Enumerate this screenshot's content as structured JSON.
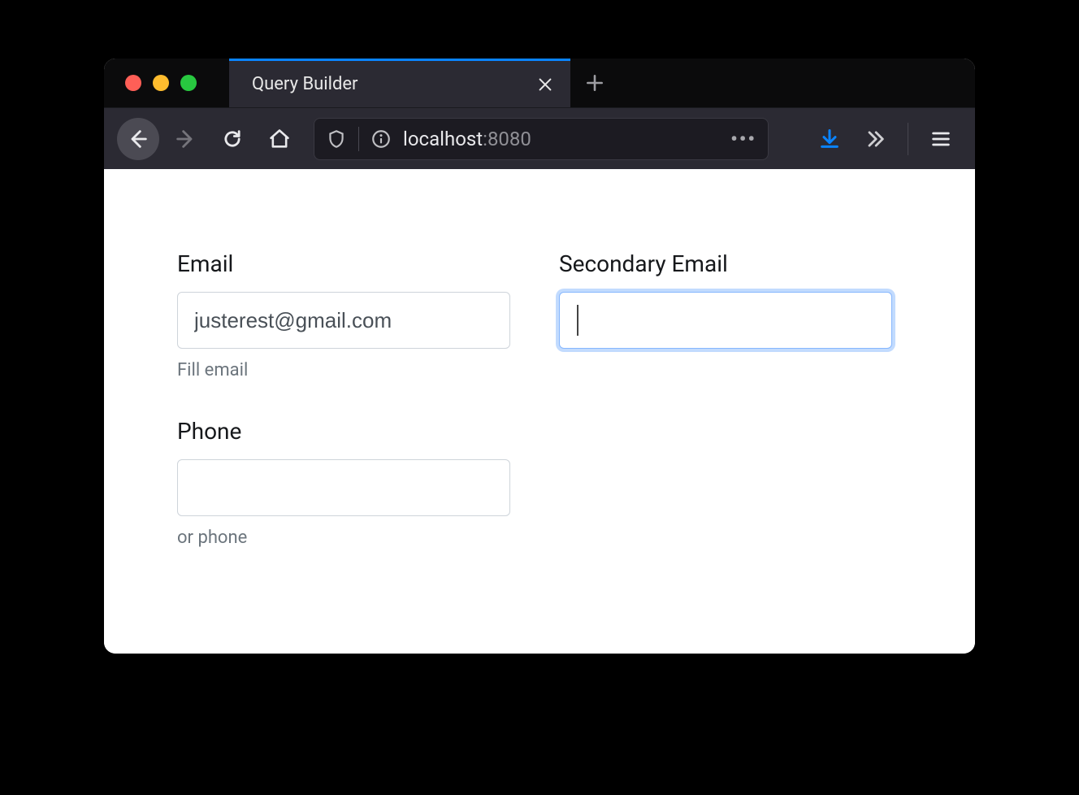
{
  "browser": {
    "tab_title": "Query Builder",
    "url_host": "localhost",
    "url_port": ":8080"
  },
  "form": {
    "email": {
      "label": "Email",
      "value": "justerest@gmail.com",
      "hint": "Fill email"
    },
    "secondary_email": {
      "label": "Secondary Email",
      "value": ""
    },
    "phone": {
      "label": "Phone",
      "value": "",
      "hint": "or phone"
    }
  }
}
